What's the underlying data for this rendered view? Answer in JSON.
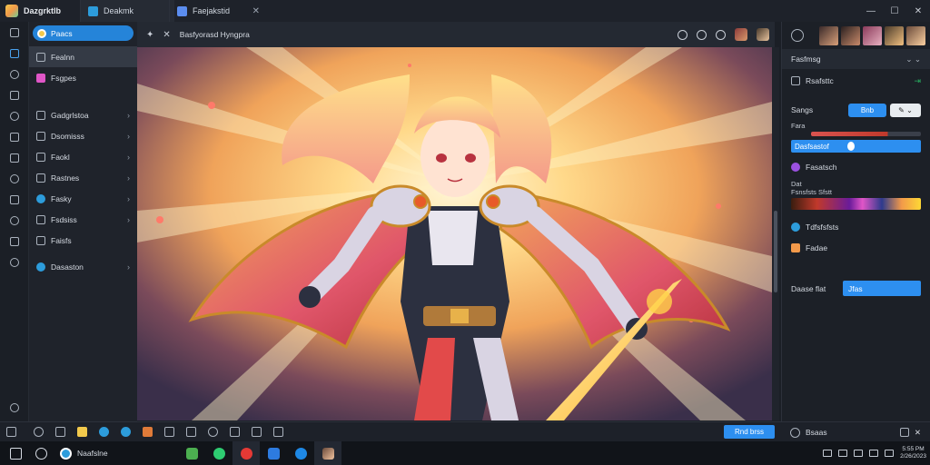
{
  "app": {
    "name": "Dazgrktlb"
  },
  "tabs": [
    {
      "label": "Deakmk",
      "icon": "document-icon"
    },
    {
      "label": "Faejakstid",
      "icon": "document-icon"
    }
  ],
  "window_controls": {
    "minimize": "—",
    "maximize": "☐",
    "close": "✕"
  },
  "sidebar": {
    "search_label": "Paacs",
    "items": [
      {
        "label": "Fealnn",
        "icon": "layers-icon",
        "arrow": "",
        "selected": true
      },
      {
        "label": "Fsgpes",
        "icon": "image-icon",
        "arrow": ""
      },
      {
        "label": "Gadgrlstoa",
        "icon": "grid-icon",
        "arrow": "›"
      },
      {
        "label": "Dsomisss",
        "icon": "palette-icon",
        "arrow": "›"
      },
      {
        "label": "Faokl",
        "icon": "brush-icon",
        "arrow": "›"
      },
      {
        "label": "Rastnes",
        "icon": "shape-icon",
        "arrow": "›"
      },
      {
        "label": "Fasky",
        "icon": "globe-icon",
        "arrow": "›"
      },
      {
        "label": "Fsdsiss",
        "icon": "sliders-icon",
        "arrow": "›"
      },
      {
        "label": "Faisfs",
        "icon": "text-icon",
        "arrow": ""
      },
      {
        "label": "Dasaston",
        "icon": "settings-icon",
        "arrow": "›"
      }
    ]
  },
  "canvas_toolbar": {
    "pin": "✦",
    "close": "✕",
    "title": "Basfyorasd Hyngpra"
  },
  "right_panel": {
    "header": {
      "label": "Fasfmsg",
      "right": "⌄ ⌄"
    },
    "preset_row": {
      "label": "Rsafsttc",
      "badge": "⇥"
    },
    "style_row": {
      "label": "Sangs",
      "on": "Bnb",
      "off": "✎ ⌄"
    },
    "red_label": "Fara",
    "select_label": "Dasfsastof",
    "effect1": "Fasatsch",
    "gradient_label_1": "Dat",
    "gradient_label_2": "Fsnsfsts Sfstt",
    "effect2": "Tdfsfsfsts",
    "effect3": "Fadae",
    "apply_label": "Daase flat",
    "apply_button": "Jfas"
  },
  "bottom_tools": {
    "render_button": "Rnd brss",
    "right_label": "Bsaas",
    "right_close": "✕"
  },
  "taskbar": {
    "search_text": "Naafslne",
    "time": "5:55 PM",
    "date": "2/26/2023"
  },
  "colors": {
    "accent": "#2d8ff0",
    "bg": "#1b1f26",
    "panel": "#1f232b"
  }
}
